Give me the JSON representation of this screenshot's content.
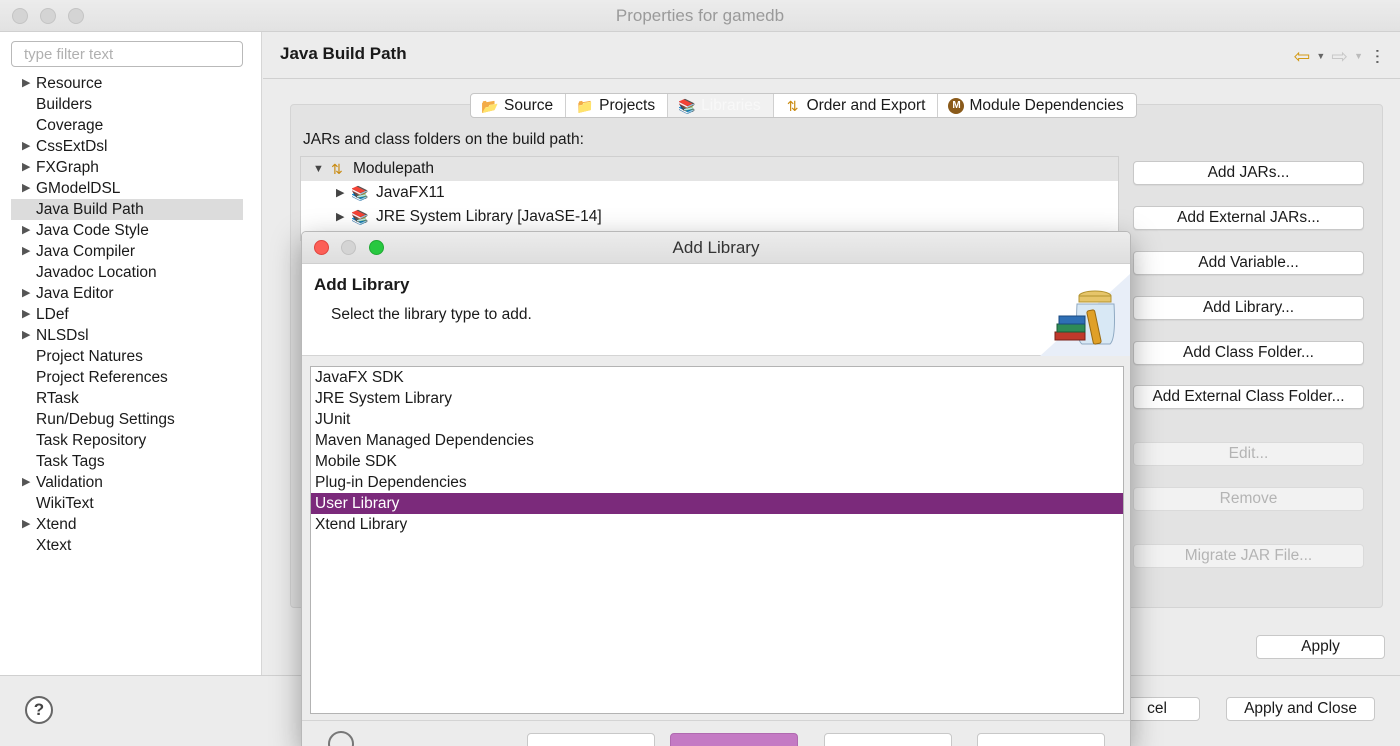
{
  "window": {
    "title": "Properties for gamedb"
  },
  "sidebar": {
    "filter_placeholder": "type filter text",
    "items": [
      {
        "label": "Resource",
        "expandable": true
      },
      {
        "label": "Builders",
        "expandable": false
      },
      {
        "label": "Coverage",
        "expandable": false
      },
      {
        "label": "CssExtDsl",
        "expandable": true
      },
      {
        "label": "FXGraph",
        "expandable": true
      },
      {
        "label": "GModelDSL",
        "expandable": true
      },
      {
        "label": "Java Build Path",
        "expandable": false,
        "selected": true
      },
      {
        "label": "Java Code Style",
        "expandable": true
      },
      {
        "label": "Java Compiler",
        "expandable": true
      },
      {
        "label": "Javadoc Location",
        "expandable": false
      },
      {
        "label": "Java Editor",
        "expandable": true
      },
      {
        "label": "LDef",
        "expandable": true
      },
      {
        "label": "NLSDsl",
        "expandable": true
      },
      {
        "label": "Project Natures",
        "expandable": false
      },
      {
        "label": "Project References",
        "expandable": false
      },
      {
        "label": "RTask",
        "expandable": false
      },
      {
        "label": "Run/Debug Settings",
        "expandable": false
      },
      {
        "label": "Task Repository",
        "expandable": false
      },
      {
        "label": "Task Tags",
        "expandable": false
      },
      {
        "label": "Validation",
        "expandable": true
      },
      {
        "label": "WikiText",
        "expandable": false
      },
      {
        "label": "Xtend",
        "expandable": true
      },
      {
        "label": "Xtext",
        "expandable": false
      }
    ]
  },
  "main": {
    "title": "Java Build Path",
    "tabs": [
      {
        "label": "Source",
        "icon": "source-folder-icon",
        "active": false
      },
      {
        "label": "Projects",
        "icon": "projects-folder-icon",
        "active": false
      },
      {
        "label": "Libraries",
        "icon": "libraries-icon",
        "active": true
      },
      {
        "label": "Order and Export",
        "icon": "order-export-icon",
        "active": false
      },
      {
        "label": "Module Dependencies",
        "icon": "module-icon",
        "active": false
      }
    ],
    "jar_label": "JARs and class folders on the build path:",
    "build_path_tree": {
      "root": "Modulepath",
      "children": [
        "JavaFX11",
        "JRE System Library [JavaSE-14]"
      ]
    },
    "buttons": {
      "add_jars": "Add JARs...",
      "add_external_jars": "Add External JARs...",
      "add_variable": "Add Variable...",
      "add_library": "Add Library...",
      "add_class_folder": "Add Class Folder...",
      "add_external_class_folder": "Add External Class Folder...",
      "edit": "Edit...",
      "remove": "Remove",
      "migrate_jar": "Migrate JAR File..."
    },
    "apply": "Apply"
  },
  "bottom": {
    "help": "?",
    "cancel": "cel",
    "apply_close": "Apply and Close"
  },
  "dialog": {
    "title": "Add Library",
    "header_title": "Add Library",
    "header_subtitle": "Select the library type to add.",
    "library_types": [
      "JavaFX SDK",
      "JRE System Library",
      "JUnit",
      "Maven Managed Dependencies",
      "Mobile SDK",
      "Plug-in Dependencies",
      "User Library",
      "Xtend Library"
    ],
    "selected_index": 6
  },
  "colors": {
    "selection": "#7b2a7b",
    "close_light": "#fc5f57",
    "zoom_light": "#28c840",
    "back_arrow": "#d39a16"
  }
}
